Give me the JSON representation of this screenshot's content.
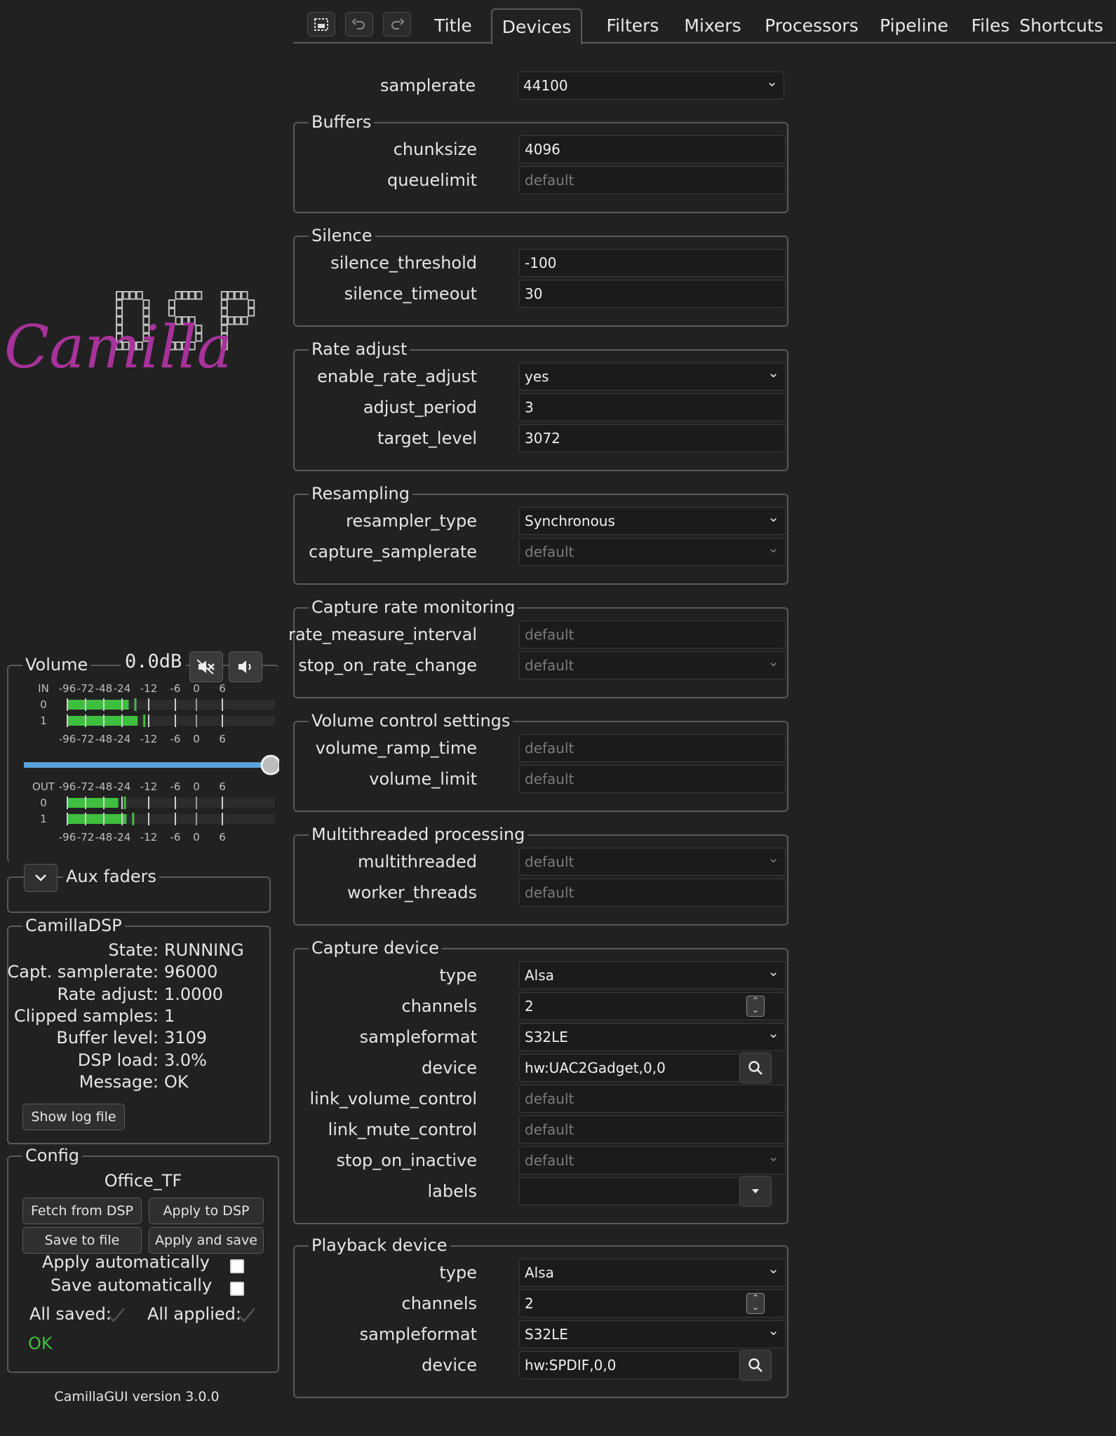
{
  "toolbar": {
    "buttons": [
      "select-area-icon",
      "undo-icon",
      "redo-icon"
    ],
    "tabs": [
      {
        "label": "Title"
      },
      {
        "label": "Devices"
      },
      {
        "label": "Filters"
      },
      {
        "label": "Mixers"
      },
      {
        "label": "Processors"
      },
      {
        "label": "Pipeline"
      },
      {
        "label": "Files"
      },
      {
        "label": "Shortcuts"
      }
    ],
    "active_tab": "Devices"
  },
  "devices": {
    "samplerate": {
      "label": "samplerate",
      "value": "44100"
    },
    "buffers": {
      "title": "Buffers",
      "chunksize": {
        "label": "chunksize",
        "value": "4096"
      },
      "queuelimit": {
        "label": "queuelimit",
        "placeholder": "default"
      }
    },
    "silence": {
      "title": "Silence",
      "silence_threshold": {
        "label": "silence_threshold",
        "value": "-100"
      },
      "silence_timeout": {
        "label": "silence_timeout",
        "value": "30"
      }
    },
    "rate_adjust": {
      "title": "Rate adjust",
      "enable_rate_adjust": {
        "label": "enable_rate_adjust",
        "value": "yes"
      },
      "adjust_period": {
        "label": "adjust_period",
        "value": "3"
      },
      "target_level": {
        "label": "target_level",
        "value": "3072"
      }
    },
    "resampling": {
      "title": "Resampling",
      "resampler_type": {
        "label": "resampler_type",
        "value": "Synchronous"
      },
      "capture_samplerate": {
        "label": "capture_samplerate",
        "placeholder": "default"
      }
    },
    "capture_rate_monitoring": {
      "title": "Capture rate monitoring",
      "rate_measure_interval": {
        "label": "rate_measure_interval",
        "placeholder": "default"
      },
      "stop_on_rate_change": {
        "label": "stop_on_rate_change",
        "placeholder": "default"
      }
    },
    "volume_control": {
      "title": "Volume control settings",
      "volume_ramp_time": {
        "label": "volume_ramp_time",
        "placeholder": "default"
      },
      "volume_limit": {
        "label": "volume_limit",
        "placeholder": "default"
      }
    },
    "multithreaded": {
      "title": "Multithreaded processing",
      "multithreaded": {
        "label": "multithreaded",
        "placeholder": "default"
      },
      "worker_threads": {
        "label": "worker_threads",
        "placeholder": "default"
      }
    },
    "capture_device": {
      "title": "Capture device",
      "type": {
        "label": "type",
        "value": "Alsa"
      },
      "channels": {
        "label": "channels",
        "value": "2"
      },
      "sampleformat": {
        "label": "sampleformat",
        "value": "S32LE"
      },
      "device": {
        "label": "device",
        "value": "hw:UAC2Gadget,0,0"
      },
      "link_volume_control": {
        "label": "link_volume_control",
        "placeholder": "default"
      },
      "link_mute_control": {
        "label": "link_mute_control",
        "placeholder": "default"
      },
      "stop_on_inactive": {
        "label": "stop_on_inactive",
        "placeholder": "default"
      },
      "labels": {
        "label": "labels",
        "value": ""
      }
    },
    "playback_device": {
      "title": "Playback device",
      "type": {
        "label": "type",
        "value": "Alsa"
      },
      "channels": {
        "label": "channels",
        "value": "2"
      },
      "sampleformat": {
        "label": "sampleformat",
        "value": "S32LE"
      },
      "device": {
        "label": "device",
        "value": "hw:SPDIF,0,0"
      }
    }
  },
  "logo": {
    "text_script": "Camilla",
    "text_block": "DSP"
  },
  "volume": {
    "title": "Volume",
    "value": "0.0dB",
    "slider_fraction": 1.0,
    "scale_labels": [
      "-96",
      "-72",
      "-48",
      "-24",
      "-12",
      "-6",
      "0",
      "6"
    ],
    "in": {
      "label": "IN",
      "channels": [
        "0",
        "1"
      ],
      "levels_db": [
        -21,
        -17
      ]
    },
    "out": {
      "label": "OUT",
      "channels": [
        "0",
        "1"
      ],
      "levels_db": [
        -29,
        -22
      ]
    }
  },
  "aux_faders": {
    "title": "Aux faders"
  },
  "status": {
    "title": "CamillaDSP",
    "rows": [
      {
        "key": "State:",
        "value": "RUNNING"
      },
      {
        "key": "Capt. samplerate:",
        "value": "96000"
      },
      {
        "key": "Rate adjust:",
        "value": "1.0000"
      },
      {
        "key": "Clipped samples:",
        "value": "1"
      },
      {
        "key": "Buffer level:",
        "value": "3109"
      },
      {
        "key": "DSP load:",
        "value": "3.0%"
      },
      {
        "key": "Message:",
        "value": "OK"
      }
    ],
    "show_log_button": "Show log file"
  },
  "config": {
    "title": "Config",
    "name": "Office_TF",
    "fetch_button": "Fetch from DSP",
    "apply_button": "Apply to DSP",
    "save_button": "Save to file",
    "apply_save_button": "Apply and save",
    "apply_auto_label": "Apply automatically",
    "apply_auto_checked": false,
    "save_auto_label": "Save automatically",
    "save_auto_checked": false,
    "all_saved_label": "All saved:",
    "all_applied_label": "All applied:",
    "status_text": "OK",
    "status_color": "#3fbf3f"
  },
  "footer": {
    "version": "CamillaGUI version 3.0.0"
  },
  "colors": {
    "accent": "#5aa3d8",
    "meter": "#3fbf3f",
    "logo": "#a8329b"
  }
}
